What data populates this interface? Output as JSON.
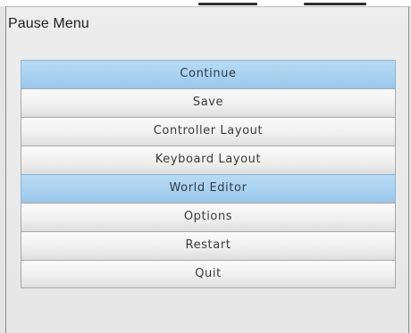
{
  "pause_menu": {
    "title": "Pause Menu",
    "items": [
      {
        "label": "Continue",
        "highlighted": true
      },
      {
        "label": "Save",
        "highlighted": false
      },
      {
        "label": "Controller Layout",
        "highlighted": false
      },
      {
        "label": "Keyboard Layout",
        "highlighted": false
      },
      {
        "label": "World Editor",
        "highlighted": true
      },
      {
        "label": "Options",
        "highlighted": false
      },
      {
        "label": "Restart",
        "highlighted": false
      },
      {
        "label": "Quit",
        "highlighted": false
      }
    ]
  },
  "colors": {
    "panel_background": "#e6e6e6",
    "button_background": "#f0f0f0",
    "button_highlight": "#a9d1f0",
    "button_text": "#3a3a3a",
    "title_text": "#1e1e1e"
  }
}
